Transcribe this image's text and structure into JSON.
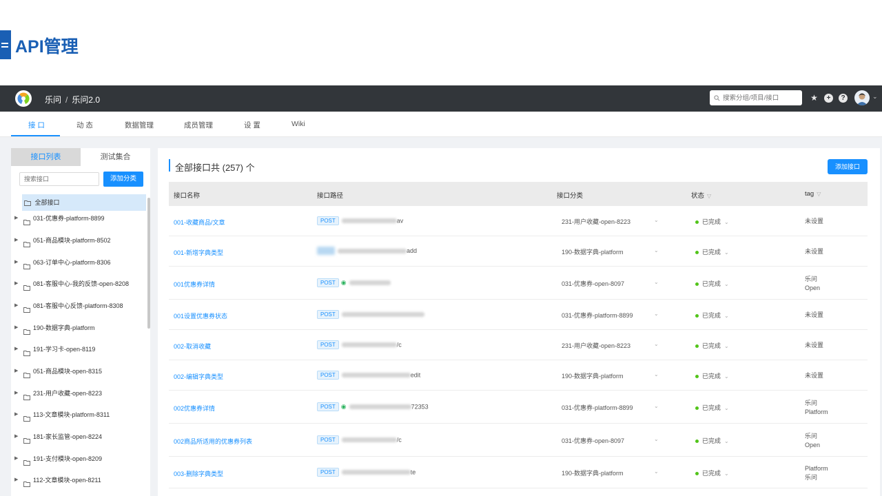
{
  "slide": {
    "title": "API管理"
  },
  "app": {
    "breadcrumb": {
      "group": "乐问",
      "project": "乐问2.0"
    },
    "search_placeholder": "搜索分组/项目/接口"
  },
  "nav": {
    "tabs": [
      "接 口",
      "动 态",
      "数据管理",
      "成员管理",
      "设 置",
      "Wiki"
    ],
    "active": 0
  },
  "left": {
    "tabs": [
      "接口列表",
      "测试集合"
    ],
    "search_placeholder": "搜索接口",
    "add_button": "添加分类",
    "all_label": "全部接口",
    "categories": [
      "031-优惠券-platform-8899",
      "051-商品模块-platform-8502",
      "063-订单中心-platform-8306",
      "081-客服中心-我的反馈-open-8208",
      "081-客服中心反馈-platform-8308",
      "190-数据字典-platform",
      "191-学习卡-open-8119",
      "051-商品模块-open-8315",
      "231-用户收藏-open-8223",
      "113-文章模块-platform-8311",
      "181-家长监管-open-8224",
      "191-支付模块-open-8209",
      "112-文章模块-open-8211"
    ]
  },
  "main": {
    "title": "全部接口共 (257) 个",
    "add_button": "添加接口",
    "columns": [
      "接口名称",
      "接口路径",
      "接口分类",
      "状态",
      "tag"
    ],
    "rows": [
      {
        "name": "001-收藏商品/文章",
        "method": "POST",
        "path_tail": "av",
        "category": "231-用户收藏-open-8223",
        "status": "已完成",
        "tag": [
          "未设置"
        ]
      },
      {
        "name": "001-新增字典类型",
        "method": "",
        "path_tail": "add",
        "category": "190-数据字典-platform",
        "status": "已完成",
        "tag": [
          "未设置"
        ]
      },
      {
        "name": "001优惠券详情",
        "method": "POST",
        "path_tail": "",
        "category": "031-优惠券-open-8097",
        "status": "已完成",
        "tag": [
          "乐问",
          "Open"
        ]
      },
      {
        "name": "001设置优惠券状态",
        "method": "POST",
        "path_tail": "",
        "category": "031-优惠券-platform-8899",
        "status": "已完成",
        "tag": [
          "未设置"
        ]
      },
      {
        "name": "002-取消收藏",
        "method": "POST",
        "path_tail": "/c",
        "category": "231-用户收藏-open-8223",
        "status": "已完成",
        "tag": [
          "未设置"
        ]
      },
      {
        "name": "002-编辑字典类型",
        "method": "POST",
        "path_tail": "edit",
        "category": "190-数据字典-platform",
        "status": "已完成",
        "tag": [
          "未设置"
        ]
      },
      {
        "name": "002优惠券详情",
        "method": "POST",
        "path_tail": "72353",
        "category": "031-优惠券-platform-8899",
        "status": "已完成",
        "tag": [
          "乐问",
          "Platform"
        ]
      },
      {
        "name": "002商品所适用的优惠券列表",
        "method": "POST",
        "path_tail": "/c",
        "category": "031-优惠券-open-8097",
        "status": "已完成",
        "tag": [
          "乐问",
          "Open"
        ]
      },
      {
        "name": "003-删除字典类型",
        "method": "POST",
        "path_tail": "te",
        "category": "190-数据字典-platform",
        "status": "已完成",
        "tag": [
          "Platform",
          "乐问"
        ]
      }
    ]
  }
}
